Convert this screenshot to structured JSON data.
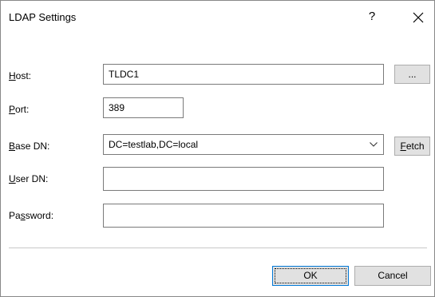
{
  "window": {
    "title": "LDAP Settings",
    "help_label": "?",
    "close_icon": "close-icon"
  },
  "form": {
    "host": {
      "label_mnemonic": "H",
      "label_rest": "ost:",
      "value": "TLDC1",
      "browse_label": "..."
    },
    "port": {
      "label_mnemonic": "P",
      "label_rest": "ort:",
      "value": "389"
    },
    "base_dn": {
      "label_mnemonic": "B",
      "label_rest": "ase DN:",
      "value": "DC=testlab,DC=local",
      "fetch_mnemonic": "F",
      "fetch_rest": "etch"
    },
    "user_dn": {
      "label_mnemonic": "U",
      "label_rest": "ser DN:",
      "value": ""
    },
    "password": {
      "label_pre": "Pa",
      "label_mnemonic": "s",
      "label_rest": "sword:",
      "value": ""
    }
  },
  "buttons": {
    "ok_label": "OK",
    "cancel_label": "Cancel"
  },
  "colors": {
    "focus_border": "#0078d7",
    "button_face": "#e1e1e1",
    "border": "#7a7a7a"
  }
}
